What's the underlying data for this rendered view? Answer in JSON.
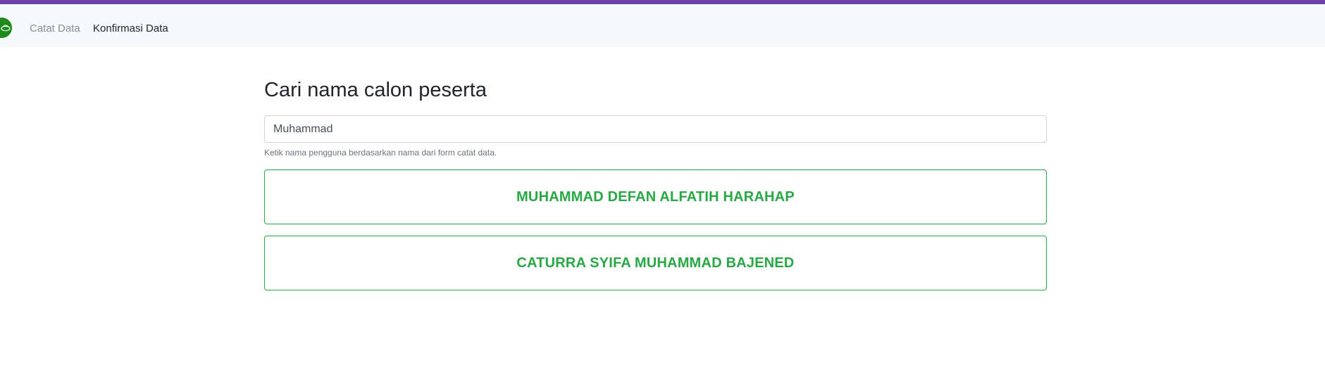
{
  "colors": {
    "accent_bar": "#6f42a8",
    "navbar_bg": "#f8f9fa",
    "success": "#28a745",
    "logo_green": "#1e8a1e"
  },
  "navbar": {
    "logo_icon": "brand-logo-icon",
    "links": [
      {
        "label": "Catat Data",
        "active": false
      },
      {
        "label": "Konfirmasi Data",
        "active": true
      }
    ]
  },
  "main": {
    "title": "Cari nama calon peserta",
    "search": {
      "value": "Muhammad",
      "placeholder": ""
    },
    "help_text": "Ketik nama pengguna berdasarkan nama dari form catat data.",
    "results": [
      {
        "name": "MUHAMMAD DEFAN ALFATIH HARAHAP"
      },
      {
        "name": "CATURRA SYIFA MUHAMMAD BAJENED"
      }
    ]
  }
}
